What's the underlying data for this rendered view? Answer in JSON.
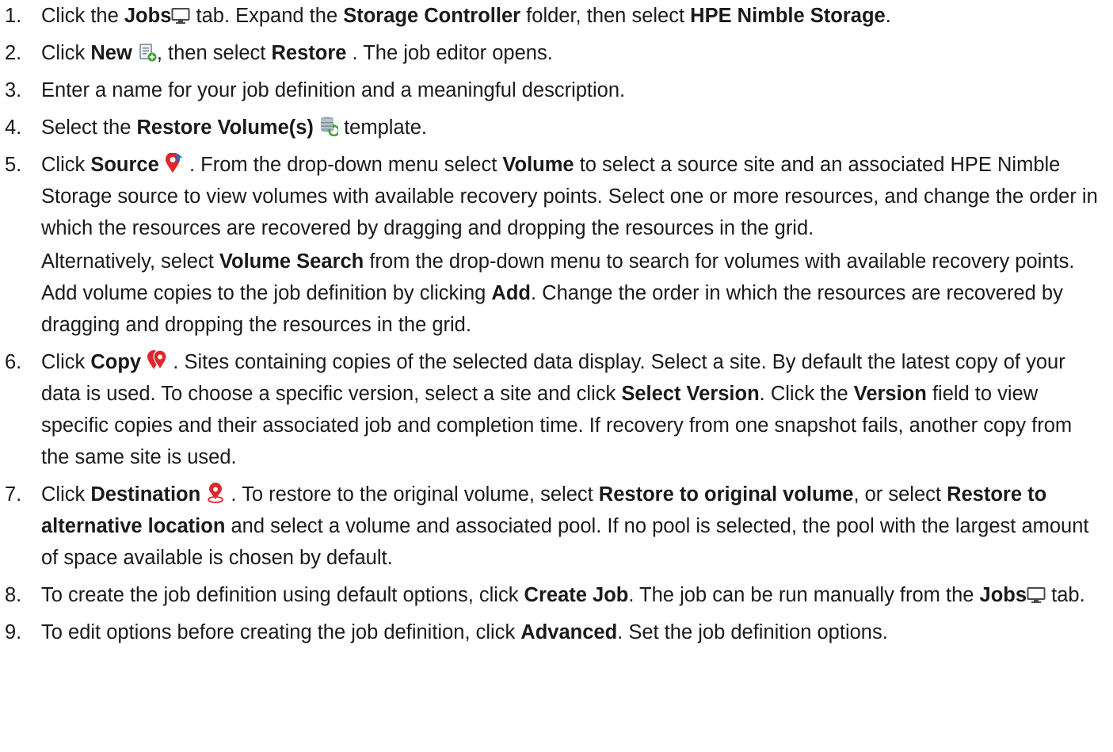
{
  "steps": [
    {
      "number": "1.",
      "segments": [
        {
          "text": "Click the "
        },
        {
          "text": "Jobs",
          "bold": true
        },
        {
          "icon": "monitor-icon"
        },
        {
          "text": " tab. Expand the "
        },
        {
          "text": "Storage Controller",
          "bold": true
        },
        {
          "text": " folder, then select "
        },
        {
          "text": "HPE Nimble Storage",
          "bold": true
        },
        {
          "text": "."
        }
      ]
    },
    {
      "number": "2.",
      "segments": [
        {
          "text": "Click "
        },
        {
          "text": "New",
          "bold": true
        },
        {
          "text": " "
        },
        {
          "icon": "new-job-icon"
        },
        {
          "text": ", then select "
        },
        {
          "text": "Restore",
          "bold": true
        },
        {
          "text": " . The job editor opens."
        }
      ]
    },
    {
      "number": "3.",
      "segments": [
        {
          "text": "Enter a name for your job definition and a meaningful description."
        }
      ]
    },
    {
      "number": "4.",
      "segments": [
        {
          "text": "Select the "
        },
        {
          "text": "Restore Volume(s)",
          "bold": true
        },
        {
          "text": " "
        },
        {
          "icon": "restore-volume-icon"
        },
        {
          "text": " template."
        }
      ]
    },
    {
      "number": "5.",
      "segments": [
        {
          "text": "Click "
        },
        {
          "text": "Source",
          "bold": true
        },
        {
          "text": " "
        },
        {
          "icon": "source-pin-icon"
        },
        {
          "text": " . From the drop-down menu select "
        },
        {
          "text": "Volume",
          "bold": true
        },
        {
          "text": " to select a source site and an associated HPE Nimble Storage source to view volumes with available recovery points. Select one or more resources, and change the order in which the resources are recovered by dragging and dropping the resources in the grid."
        }
      ],
      "extra": [
        {
          "text": "Alternatively, select "
        },
        {
          "text": "Volume Search",
          "bold": true
        },
        {
          "text": " from the drop-down menu to search for volumes with available recovery points. Add volume copies to the job definition by clicking "
        },
        {
          "text": "Add",
          "bold": true
        },
        {
          "text": ". Change the order in which the resources are recovered by dragging and dropping the resources in the grid."
        }
      ]
    },
    {
      "number": "6.",
      "segments": [
        {
          "text": "Click "
        },
        {
          "text": "Copy",
          "bold": true
        },
        {
          "text": " "
        },
        {
          "icon": "copy-pin-icon"
        },
        {
          "text": " . Sites containing copies of the selected data display. Select a site. By default the latest copy of your data is used. To choose a specific version, select a site and click "
        },
        {
          "text": "Select Version",
          "bold": true
        },
        {
          "text": ". Click the "
        },
        {
          "text": "Version",
          "bold": true
        },
        {
          "text": " field to view specific copies and their associated job and completion time. If recovery from one snapshot fails, another copy from the same site is used."
        }
      ]
    },
    {
      "number": "7.",
      "segments": [
        {
          "text": "Click "
        },
        {
          "text": "Destination",
          "bold": true
        },
        {
          "text": " "
        },
        {
          "icon": "destination-pin-icon"
        },
        {
          "text": " . To restore to the original volume, select "
        },
        {
          "text": "Restore to original volume",
          "bold": true
        },
        {
          "text": ", or select "
        },
        {
          "text": "Restore to alternative location",
          "bold": true
        },
        {
          "text": " and select a volume and associated pool. If no pool is selected, the pool with the largest amount of space available is chosen by default."
        }
      ]
    },
    {
      "number": "8.",
      "segments": [
        {
          "text": "To create the job definition using default options, click "
        },
        {
          "text": "Create Job",
          "bold": true
        },
        {
          "text": ". The job can be run manually from the "
        },
        {
          "text": "Jobs",
          "bold": true
        },
        {
          "icon": "monitor-icon"
        },
        {
          "text": " tab."
        }
      ]
    },
    {
      "number": "9.",
      "segments": [
        {
          "text": "To edit options before creating the job definition, click "
        },
        {
          "text": "Advanced",
          "bold": true
        },
        {
          "text": ". Set the job definition options."
        }
      ]
    }
  ]
}
